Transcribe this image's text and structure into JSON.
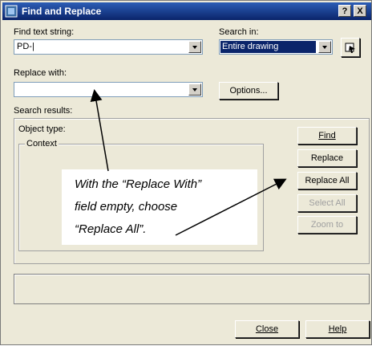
{
  "dialog": {
    "title": "Find and Replace",
    "help_glyph": "?",
    "close_glyph": "X"
  },
  "find": {
    "label": "Find text string:",
    "value": "PD-|"
  },
  "search_in": {
    "label": "Search in:",
    "value": "Entire drawing"
  },
  "replace_with": {
    "label": "Replace with:",
    "value": ""
  },
  "options_label": "Options...",
  "results": {
    "label": "Search results:",
    "object_type_label": "Object type:",
    "context_label": "Context"
  },
  "buttons": {
    "find": "Find",
    "replace": "Replace",
    "replace_all": "Replace All",
    "select_all": "Select All",
    "zoom_to": "Zoom to",
    "close": "Close",
    "help": "Help"
  },
  "annotation": {
    "line1": "With the “Replace With”",
    "line2": "field empty, choose",
    "line3": "“Replace All”."
  },
  "colors": {
    "title_bar": "#0a246a",
    "selection": "#0a246a",
    "dialog_bg": "#ece9d8"
  },
  "icons": {
    "app": "app-icon",
    "pick": "select-objects-icon"
  }
}
